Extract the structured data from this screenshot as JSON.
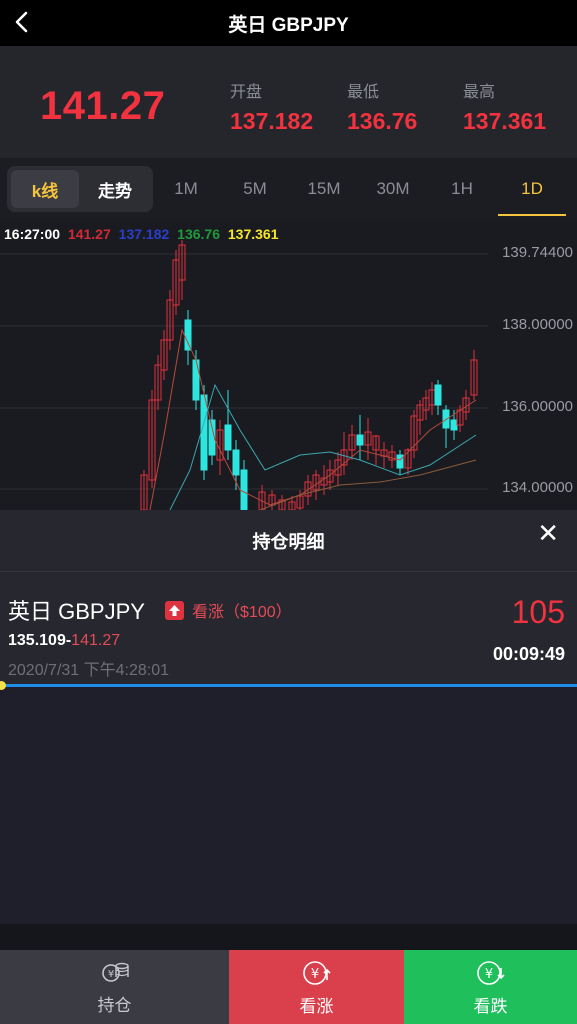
{
  "header": {
    "title": "英日 GBPJPY"
  },
  "quote": {
    "price": "141.27",
    "stats": [
      {
        "label": "开盘",
        "value": "137.182"
      },
      {
        "label": "最低",
        "value": "136.76"
      },
      {
        "label": "最高",
        "value": "137.361"
      }
    ]
  },
  "tabs": {
    "kline": "k线",
    "trend": "走势",
    "periods": [
      "1M",
      "5M",
      "15M",
      "30M",
      "1H",
      "1D"
    ],
    "active_period": "1D"
  },
  "chart": {
    "ohlc": {
      "time": "16:27:00",
      "close": "141.27",
      "open": "137.182",
      "low": "136.76",
      "high": "137.361"
    },
    "axis_labels": [
      "139.74400",
      "138.00000",
      "136.00000",
      "134.00000"
    ]
  },
  "chart_data": {
    "type": "candlestick",
    "y_ticks": [
      139.744,
      138.0,
      136.0,
      134.0
    ],
    "colors": {
      "up": "#e0323e",
      "down": "#2ee6e0",
      "ma1": "#b84a3d",
      "ma2": "#3aa8b0",
      "ma3": "#8a5a3a"
    }
  },
  "sheet": {
    "title": "持仓明细",
    "position": {
      "name": "英日 GBPJPY",
      "direction": "看涨",
      "amount": "（$100）",
      "open_price": "135.109-",
      "current_price": "141.27",
      "date": "2020/7/31 下午4:28:01",
      "profit": "105",
      "countdown": "00:09:49"
    }
  },
  "footer": {
    "hold": "持仓",
    "up": "看涨",
    "down": "看跌"
  }
}
